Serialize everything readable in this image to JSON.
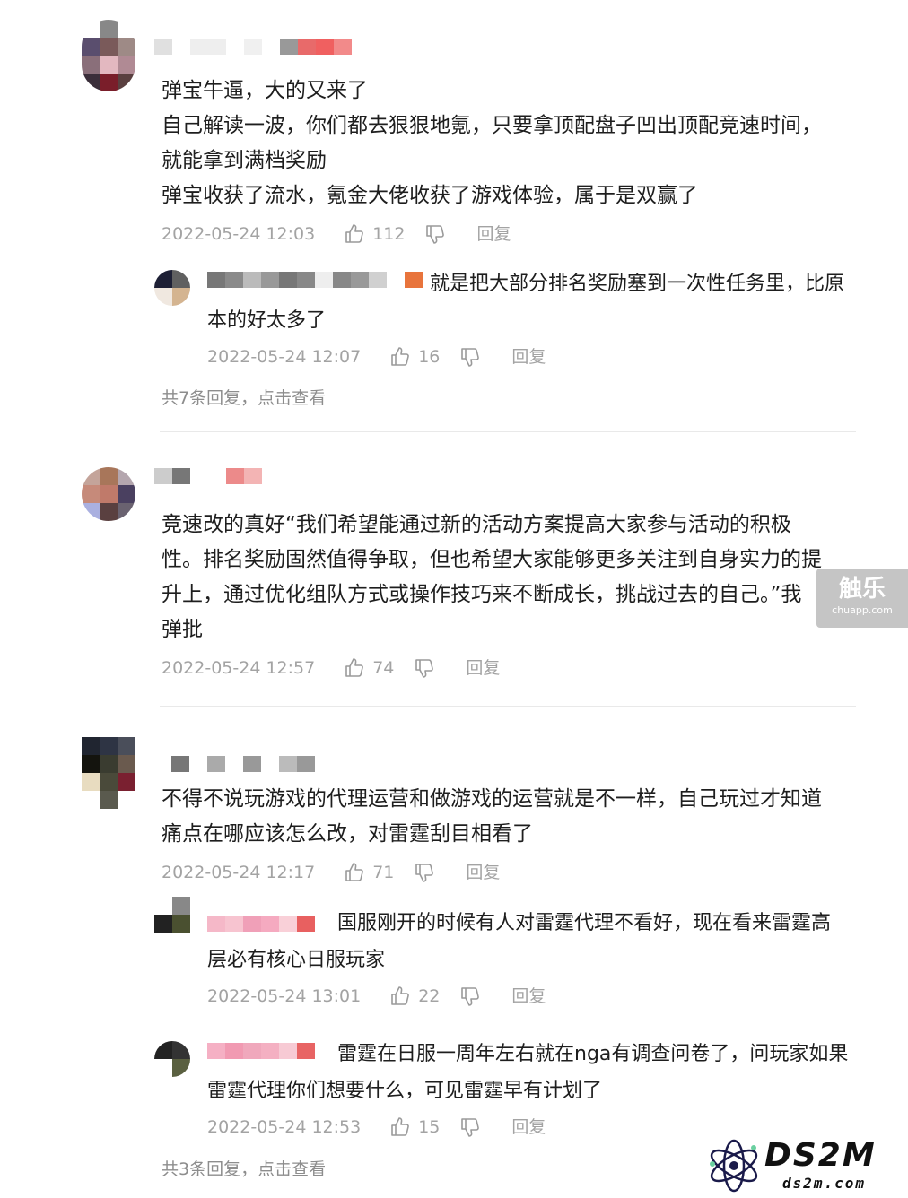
{
  "comments": [
    {
      "lines": [
        "弹宝牛逼，大的又来了",
        "自己解读一波，你们都去狠狠地氪，只要拿顶配盘子凹出顶配竞速时间，",
        "就能拿到满档奖励",
        "弹宝收获了流水，氪金大佬收获了游戏体验，属于是双赢了"
      ],
      "date": "2022-05-24 12:03",
      "likes": "112",
      "reply_label": "回复",
      "replies": [
        {
          "lines": [
            "就是把大部分排名奖励塞到一次性任务里，比原",
            "本的好太多了"
          ],
          "date": "2022-05-24 12:07",
          "likes": "16",
          "reply_label": "回复"
        }
      ],
      "more_text": "共7条回复，点击查看"
    },
    {
      "lines": [
        "竞速改的真好“我们希望能通过新的活动方案提高大家参与活动的积极",
        "性。排名奖励固然值得争取，但也希望大家能够更多关注到自身实力的提",
        "升上，通过优化组队方式或操作技巧来不断成长，挑战过去的自己。”我",
        "弹批"
      ],
      "date": "2022-05-24 12:57",
      "likes": "74",
      "reply_label": "回复"
    },
    {
      "lines": [
        "不得不说玩游戏的代理运营和做游戏的运营就是不一样，自己玩过才知道",
        "痛点在哪应该怎么改，对雷霆刮目相看了"
      ],
      "date": "2022-05-24 12:17",
      "likes": "71",
      "reply_label": "回复",
      "replies": [
        {
          "lines": [
            "国服刚开的时候有人对雷霆代理不看好，现在看来雷霆高",
            "层必有核心日服玩家"
          ],
          "date": "2022-05-24 13:01",
          "likes": "22",
          "reply_label": "回复"
        },
        {
          "lines": [
            "雷霆在日服一周年左右就在nga有调查问卷了，问玩家如果",
            "雷霆代理你们想要什么，可见雷霆早有计划了"
          ],
          "date": "2022-05-24 12:53",
          "likes": "15",
          "reply_label": "回复"
        }
      ],
      "more_text": "共3条回复，点击查看"
    }
  ],
  "watermarks": {
    "chuapp_logo": "触乐",
    "chuapp_url": "chuapp.com",
    "ds2m_logo": "DS2M",
    "ds2m_url": "ds2m.com"
  },
  "icons": {
    "like": "thumbs-up-icon",
    "dislike": "thumbs-down-icon"
  },
  "colors": {
    "meta_gray": "#a3a3a3",
    "text": "#1e1e1e"
  }
}
